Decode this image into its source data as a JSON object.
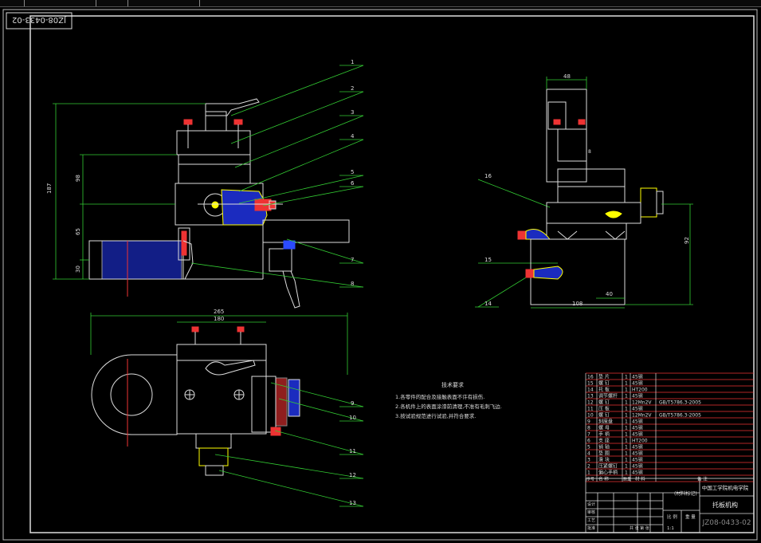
{
  "drawing": {
    "code_rotated": "JZ08-0433-02",
    "code_bottom": "JZ08-0433-02",
    "title": "托板机构",
    "school": "中国工学院机电学院"
  },
  "callouts": [
    "1",
    "2",
    "3",
    "4",
    "5",
    "6",
    "7",
    "8",
    "9",
    "10",
    "11",
    "12",
    "13",
    "14",
    "15",
    "16"
  ],
  "dimensions": {
    "height_total": "187",
    "d_98": "98",
    "d_65": "65",
    "d_30": "30",
    "width_total": "265",
    "width_180": "180",
    "top_48": "48",
    "side_92": "92",
    "base_108": "108",
    "base_40": "40",
    "small_8": "8"
  },
  "tech_requirements": {
    "heading": "技术要求",
    "lines": [
      "1.各零件的配合及接触表面不许有损伤.",
      "2.各机件上的表面涂漆前清理,不准有毛刺飞边.",
      "3.按试验规范进行试验,并符合要求."
    ]
  },
  "parts_list": [
    {
      "no": "16",
      "name": "垫 片",
      "qty": "1",
      "material": "45钢",
      "note": ""
    },
    {
      "no": "15",
      "name": "螺 钉",
      "qty": "1",
      "material": "45钢",
      "note": ""
    },
    {
      "no": "14",
      "name": "托 板",
      "qty": "1",
      "material": "HT200",
      "note": ""
    },
    {
      "no": "13",
      "name": "调节螺杆",
      "qty": "1",
      "material": "45钢",
      "note": ""
    },
    {
      "no": "12",
      "name": "螺 钉",
      "qty": "1",
      "material": "12Mn2V",
      "note": "GB/T5786.3-2005"
    },
    {
      "no": "11",
      "name": "压 板",
      "qty": "1",
      "material": "45钢",
      "note": ""
    },
    {
      "no": "10",
      "name": "螺 钉",
      "qty": "1",
      "material": "12Mn2V",
      "note": "GB/T5786.3-2005"
    },
    {
      "no": "9",
      "name": "刻度盘",
      "qty": "1",
      "material": "45钢",
      "note": ""
    },
    {
      "no": "8",
      "name": "螺 母",
      "qty": "1",
      "material": "45钢",
      "note": ""
    },
    {
      "no": "7",
      "name": "手 柄",
      "qty": "1",
      "material": "45钢",
      "note": ""
    },
    {
      "no": "6",
      "name": "支 座",
      "qty": "1",
      "material": "HT200",
      "note": ""
    },
    {
      "no": "5",
      "name": "销 轴",
      "qty": "1",
      "material": "45钢",
      "note": ""
    },
    {
      "no": "4",
      "name": "垫 圈",
      "qty": "1",
      "material": "45钢",
      "note": ""
    },
    {
      "no": "3",
      "name": "滑 块",
      "qty": "1",
      "material": "45钢",
      "note": ""
    },
    {
      "no": "2",
      "name": "压紧螺钉",
      "qty": "1",
      "material": "45钢",
      "note": ""
    },
    {
      "no": "1",
      "name": "偏心手柄",
      "qty": "1",
      "material": "45钢",
      "note": ""
    }
  ],
  "parts_header": {
    "no": "序号",
    "name": "名 称",
    "qty": "数量",
    "material": "材 料",
    "note": "备 注"
  },
  "title_block": {
    "material_label": "(材料标记)",
    "scale_label": "比 例",
    "weight_label": "重 量",
    "sheet_label": "共 张 第 张",
    "design": "设计",
    "check": "审核",
    "process": "工艺",
    "approve": "批准",
    "scale_value": "1:1"
  }
}
